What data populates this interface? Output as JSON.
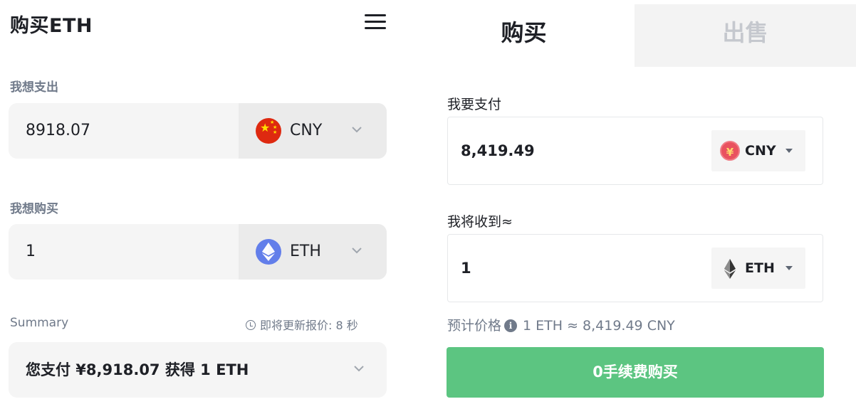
{
  "left": {
    "title": "购买ETH",
    "spend_label": "我想支出",
    "spend_value": "8918.07",
    "spend_currency": "CNY",
    "buy_label": "我想购买",
    "buy_value": "1",
    "buy_currency": "ETH",
    "summary_label": "Summary",
    "refresh_text": "即将更新报价:  8 秒",
    "summary_text": "您支付 ¥8,918.07 获得 1 ETH"
  },
  "right": {
    "tab_buy": "购买",
    "tab_sell": "出售",
    "pay_label": "我要支付",
    "pay_value": "8,419.49",
    "pay_currency": "CNY",
    "pay_coin_symbol": "¥",
    "receive_label": "我将收到≈",
    "receive_value": "1",
    "receive_currency": "ETH",
    "est_label": "预计价格",
    "est_value": "1 ETH ≈ 8,419.49 CNY",
    "buy_button": "0手续费购买"
  },
  "colors": {
    "buy_button": "#5cc581",
    "eth_blue": "#627eea",
    "cny_red": "#de2910",
    "muted_text": "#707a8a"
  },
  "icons": [
    "menu-icon",
    "china-flag-icon",
    "ethereum-icon",
    "chevron-down-icon",
    "clock-icon",
    "yen-coin-icon",
    "info-icon",
    "caret-down-icon"
  ]
}
